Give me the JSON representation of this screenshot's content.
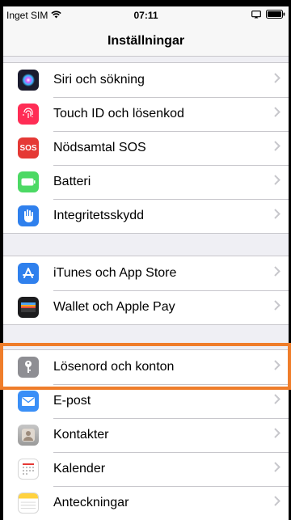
{
  "status_bar": {
    "carrier": "Inget SIM",
    "time": "07:11"
  },
  "nav": {
    "title": "Inställningar"
  },
  "groups": [
    {
      "items": [
        {
          "label": "Siri och sökning",
          "icon": "siri-icon",
          "color": "#1b1b2e"
        },
        {
          "label": "Touch ID och lösenkod",
          "icon": "fingerprint-icon",
          "color": "#ff2d55"
        },
        {
          "label": "Nödsamtal SOS",
          "icon": "sos-icon",
          "icon_text": "SOS",
          "color": "#e53935"
        },
        {
          "label": "Batteri",
          "icon": "battery-icon",
          "color": "#4cd964"
        },
        {
          "label": "Integritetsskydd",
          "icon": "hand-icon",
          "color": "#2f80ed"
        }
      ]
    },
    {
      "items": [
        {
          "label": "iTunes och App Store",
          "icon": "app-store-icon",
          "color": "#2f80ed"
        },
        {
          "label": "Wallet och Apple Pay",
          "icon": "wallet-icon",
          "color": "#1c1c1e"
        }
      ]
    },
    {
      "items": [
        {
          "label": "Lösenord och konton",
          "icon": "key-icon",
          "color": "#8e8e93",
          "highlighted": true
        },
        {
          "label": "E-post",
          "icon": "mail-icon",
          "color": "#3a8ff7"
        },
        {
          "label": "Kontakter",
          "icon": "contacts-icon",
          "color": "#a5a5a5"
        },
        {
          "label": "Kalender",
          "icon": "calendar-icon",
          "color": "#ffffff"
        },
        {
          "label": "Anteckningar",
          "icon": "notes-icon",
          "color": "#ffd23f"
        }
      ]
    }
  ],
  "highlight_color": "#ef7d2a"
}
